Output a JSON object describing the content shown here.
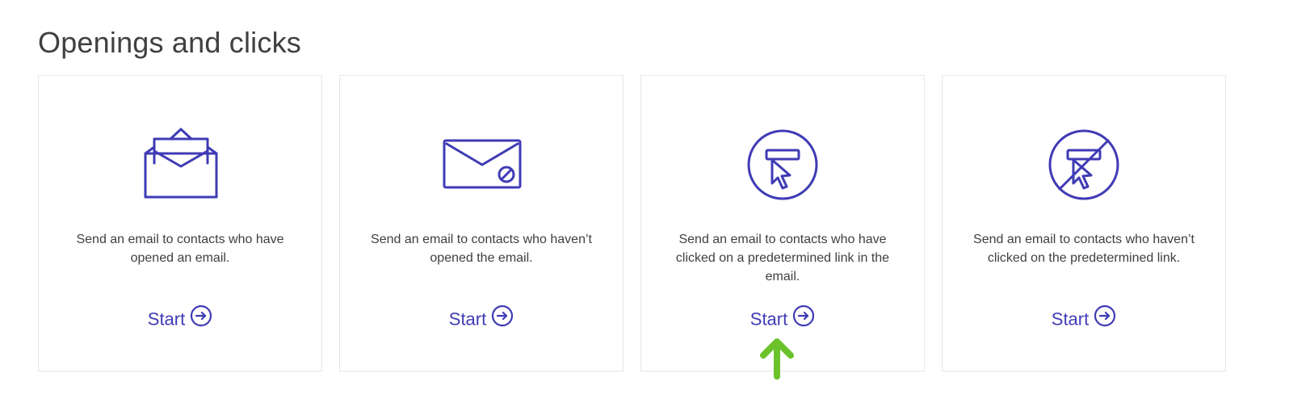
{
  "page": {
    "title": "Openings and clicks"
  },
  "colors": {
    "accent": "#3f3bb5",
    "annotation_arrow": "#6cc22a",
    "card_border": "#e6e6e6"
  },
  "cards": [
    {
      "icon": "envelope-open-icon",
      "description_lines": [
        "Send an email to contacts who have",
        "opened an email."
      ],
      "start_label": "Start"
    },
    {
      "icon": "envelope-unopened-icon",
      "description_lines": [
        "Send an email to contacts who haven’t",
        "opened the email."
      ],
      "start_label": "Start"
    },
    {
      "icon": "link-clicked-icon",
      "description_lines": [
        "Send an email to contacts who have",
        "clicked on a predetermined link in the",
        "email."
      ],
      "start_label": "Start"
    },
    {
      "icon": "link-not-clicked-icon",
      "description_lines": [
        "Send an email to contacts who haven’t",
        "clicked on the predetermined link."
      ],
      "start_label": "Start"
    }
  ],
  "annotation": {
    "icon": "green-up-arrow-icon",
    "target": "card 3 start link"
  }
}
